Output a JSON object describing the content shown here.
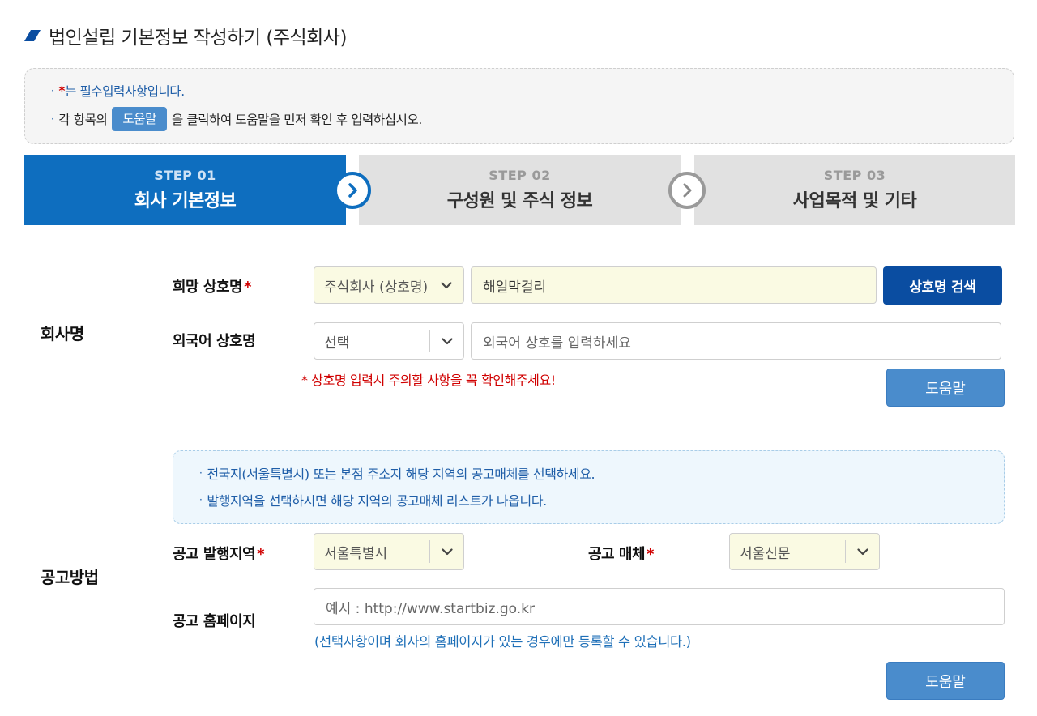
{
  "page_title": "법인설립 기본정보 작성하기 (주식회사)",
  "notice": {
    "bullet": "·",
    "line1_mark": "*",
    "line1_text": "는 필수입력사항입니다.",
    "line2_prefix": "각 항목의",
    "line2_chip": "도움말",
    "line2_suffix": "을 클릭하여 도움말을 먼저 확인 후 입력하십시오."
  },
  "steps": [
    {
      "num": "STEP 01",
      "name": "회사 기본정보"
    },
    {
      "num": "STEP 02",
      "name": "구성원 및 주식 정보"
    },
    {
      "num": "STEP 03",
      "name": "사업목적 및 기타"
    }
  ],
  "company_name": {
    "section_label": "회사명",
    "desired_label": "희망 상호명",
    "required_mark": "*",
    "type_select": "주식회사 (상호명)",
    "name_value": "해일막걸리",
    "search_button": "상호명 검색",
    "foreign_label": "외국어 상호명",
    "foreign_select": "선택",
    "foreign_placeholder": "외국어 상호를 입력하세요",
    "warning": "* 상호명 입력시 주의할 사항을 꼭 확인해주세요!",
    "help_button": "도움말"
  },
  "announcement": {
    "section_label": "공고방법",
    "info_line1": "전국지(서울특별시) 또는 본점 주소지 해당 지역의 공고매체를 선택하세요.",
    "info_line2": "발행지역을 선택하시면 해당 지역의 공고매체 리스트가 나옵니다.",
    "region_label": "공고 발행지역",
    "region_value": "서울특별시",
    "media_label": "공고 매체",
    "media_value": "서울신문",
    "homepage_label": "공고 홈페이지",
    "homepage_placeholder": "예시 : http://www.startbiz.go.kr",
    "homepage_hint": "(선택사항이며 회사의 홈페이지가 있는 경우에만 등록할 수 있습니다.)",
    "help_button": "도움말"
  },
  "colors": {
    "primary": "#0e6ebf",
    "search_button": "#0a4da1",
    "help_button": "#4a8ccc",
    "required": "#d00000",
    "field_fill": "#fafae3"
  }
}
